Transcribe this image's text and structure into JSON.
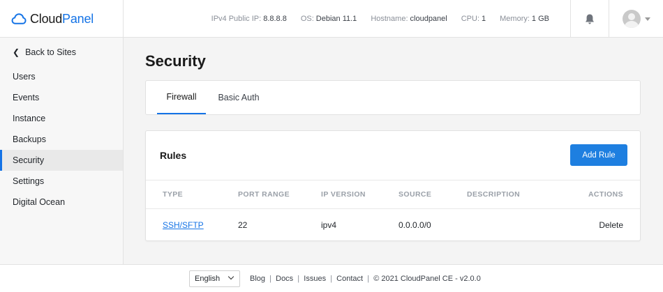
{
  "brand": {
    "part1": "Cloud",
    "part2": "Panel",
    "accent": "#1473e6"
  },
  "sysinfo": [
    {
      "key": "IPv4 Public IP:",
      "value": "8.8.8.8"
    },
    {
      "key": "OS:",
      "value": "Debian 11.1"
    },
    {
      "key": "Hostname:",
      "value": "cloudpanel"
    },
    {
      "key": "CPU:",
      "value": "1"
    },
    {
      "key": "Memory:",
      "value": "1 GB"
    }
  ],
  "header_icons": {
    "bell": "bell-icon",
    "avatar": "user-avatar-icon"
  },
  "sidebar": {
    "back_label": "Back to Sites",
    "items": [
      {
        "label": "Users"
      },
      {
        "label": "Events"
      },
      {
        "label": "Instance"
      },
      {
        "label": "Backups"
      },
      {
        "label": "Security",
        "active": true
      },
      {
        "label": "Settings"
      },
      {
        "label": "Digital Ocean"
      }
    ]
  },
  "page": {
    "title": "Security"
  },
  "tabs": [
    {
      "label": "Firewall",
      "active": true
    },
    {
      "label": "Basic Auth"
    }
  ],
  "rules": {
    "title": "Rules",
    "add_button": "Add Rule",
    "columns": [
      "TYPE",
      "PORT RANGE",
      "IP VERSION",
      "SOURCE",
      "DESCRIPTION",
      "ACTIONS"
    ],
    "rows": [
      {
        "type": "SSH/SFTP",
        "port_range": "22",
        "ip_version": "ipv4",
        "source": "0.0.0.0/0",
        "description": "",
        "action": "Delete"
      }
    ]
  },
  "footer": {
    "language": "English",
    "links": [
      "Blog",
      "Docs",
      "Issues",
      "Contact"
    ],
    "copyright": "© 2021 CloudPanel CE - v2.0.0"
  }
}
